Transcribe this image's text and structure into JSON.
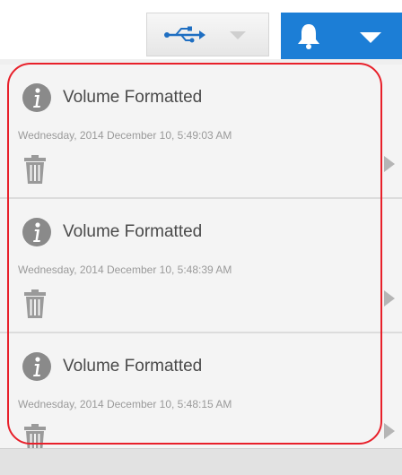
{
  "toolbar": {
    "usb_icon": "usb-icon",
    "bell_icon": "bell-icon",
    "accent_color": "#1c7ed6"
  },
  "notifications": [
    {
      "title": "Volume Formatted",
      "time": "Wednesday, 2014 December 10, 5:49:03 AM",
      "icon": "info-icon",
      "action_icon": "trash-icon"
    },
    {
      "title": "Volume Formatted",
      "time": "Wednesday, 2014 December 10, 5:48:39 AM",
      "icon": "info-icon",
      "action_icon": "trash-icon"
    },
    {
      "title": "Volume Formatted",
      "time": "Wednesday, 2014 December 10, 5:48:15 AM",
      "icon": "info-icon",
      "action_icon": "trash-icon"
    }
  ],
  "highlight_color": "#e8202a"
}
